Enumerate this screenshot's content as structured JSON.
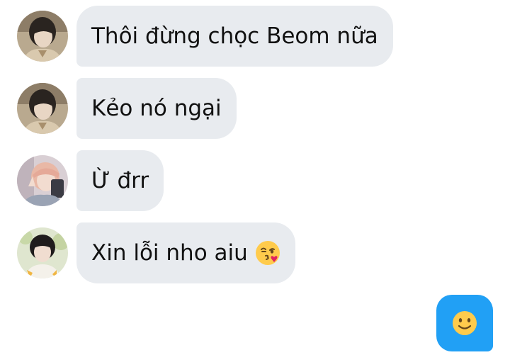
{
  "messages": [
    {
      "sender_avatar": "avatar-photo",
      "text": "Thôi đừng chọc Beom nữa"
    },
    {
      "sender_avatar": "avatar-photo",
      "text": "Kẻo nó ngại"
    },
    {
      "sender_avatar": "avatar-photo",
      "text": "Ừ đrr"
    },
    {
      "sender_avatar": "avatar-photo",
      "text": "Xin lỗi nho aiu",
      "trailing_emoji": "face-blowing-a-kiss-icon"
    }
  ],
  "reaction_button": {
    "icon": "slightly-smiling-face-icon",
    "color": "#21a0f5"
  },
  "colors": {
    "bubble_background": "#e8ebef",
    "text": "#111111",
    "accent": "#21a0f5"
  }
}
